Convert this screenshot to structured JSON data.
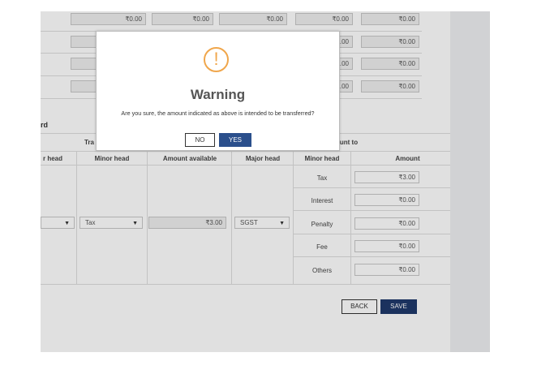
{
  "top_rows": {
    "rows": [
      [
        "₹0.00",
        "₹0.00",
        "₹0.00",
        "₹0.00",
        "₹0.00"
      ],
      [
        "",
        "",
        "",
        ".00",
        "₹0.00"
      ],
      [
        "",
        "",
        "",
        ".00",
        "₹0.00"
      ],
      [
        "",
        "",
        "",
        ".00",
        "₹0.00"
      ]
    ]
  },
  "section": {
    "label": "rd"
  },
  "table": {
    "group_left": "Tra",
    "group_right": "unt to",
    "headers": {
      "major_left": "r head",
      "minor_left": "Minor head",
      "amount_available": "Amount available",
      "major": "Major head",
      "minor": "Minor head",
      "amount": "Amount"
    },
    "transfer_from": {
      "major_value": "",
      "minor_value": "Tax",
      "amount_available": "₹3.00"
    },
    "transfer_to": {
      "major_value": "SGST",
      "rows": [
        {
          "minor": "Tax",
          "amount": "₹3.00"
        },
        {
          "minor": "Interest",
          "amount": "₹0.00"
        },
        {
          "minor": "Penalty",
          "amount": "₹0.00"
        },
        {
          "minor": "Fee",
          "amount": "₹0.00"
        },
        {
          "minor": "Others",
          "amount": "₹0.00"
        }
      ]
    }
  },
  "actions": {
    "back": "BACK",
    "save": "SAVE"
  },
  "modal": {
    "icon": "exclamation-circle-icon",
    "title": "Warning",
    "message": "Are you sure, the amount indicated as above is intended to be transferred?",
    "no": "NO",
    "yes": "YES"
  },
  "colors": {
    "warning": "#f0a64b",
    "primary": "#2b4f8c",
    "save": "#1f3a6b"
  }
}
